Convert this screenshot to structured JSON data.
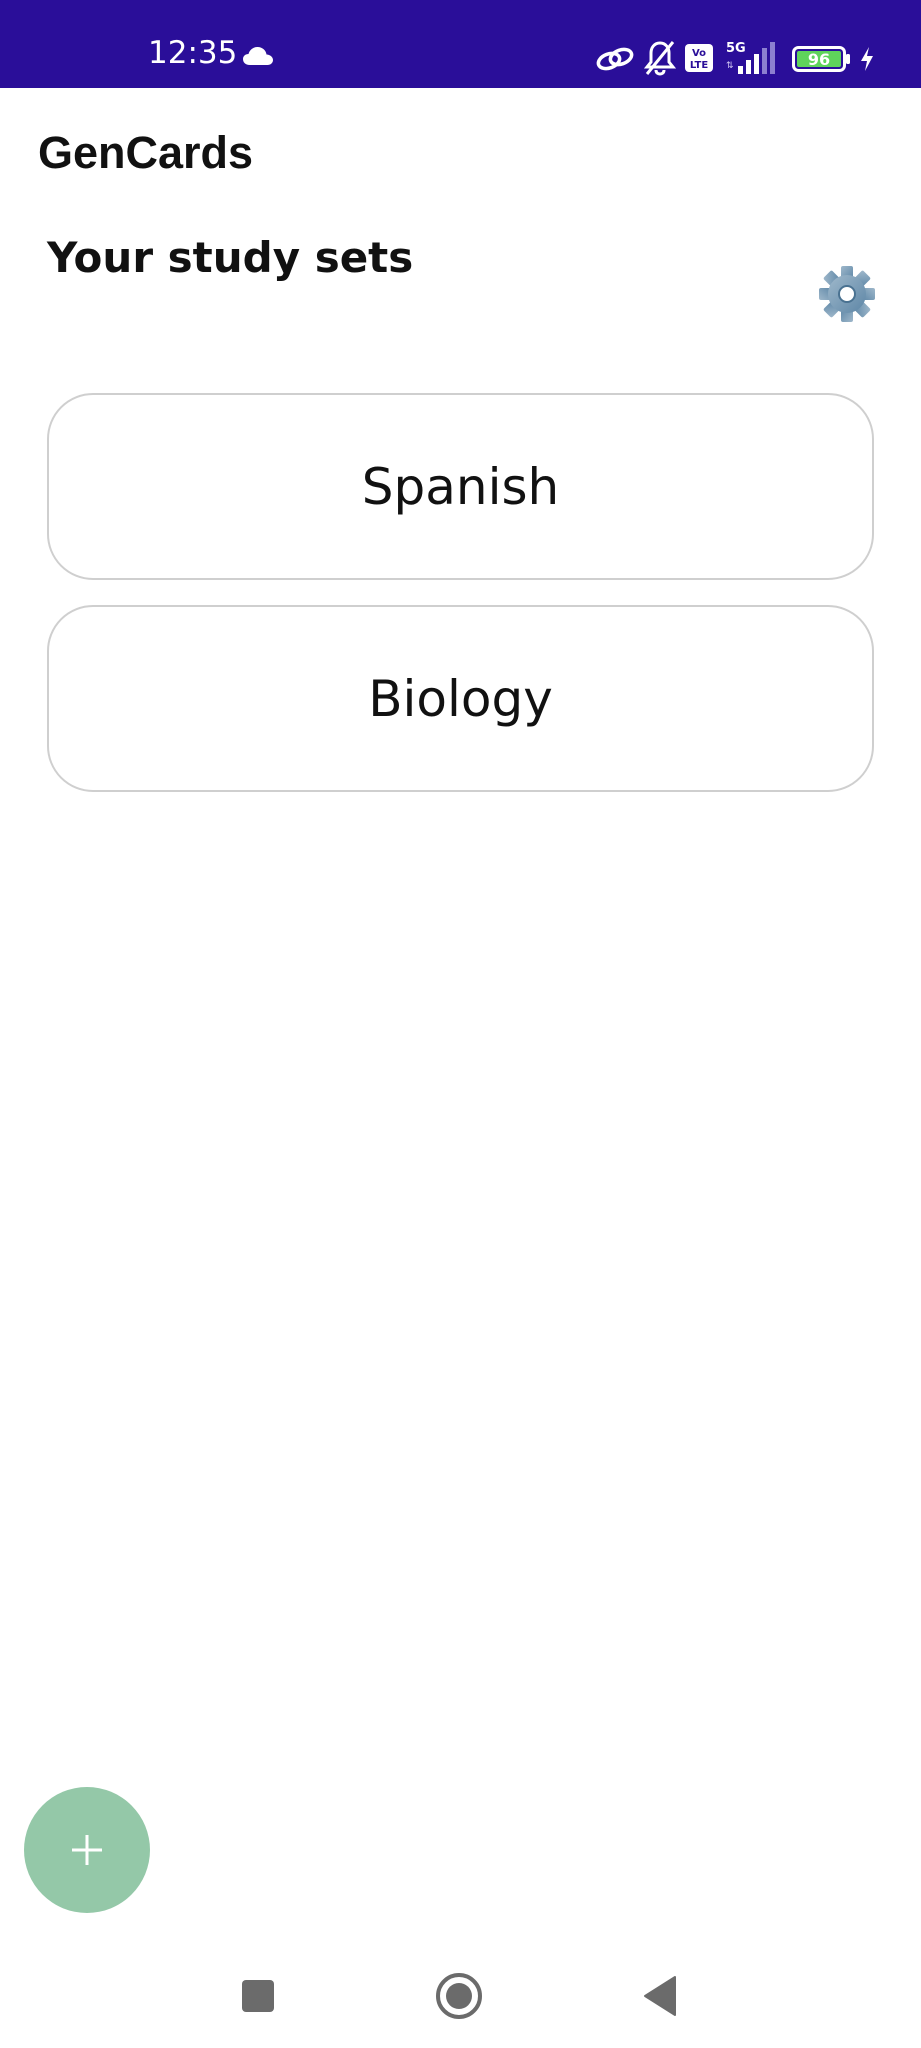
{
  "status_bar": {
    "time": "12:35",
    "battery_level": "96",
    "network": "5G",
    "volte": "Vo LTE",
    "background_color": "#2a0e99",
    "icons": [
      "cloud-icon",
      "link-icon",
      "bell-off-icon",
      "volte-icon",
      "signal-5g-icon",
      "battery-icon",
      "charging-bolt-icon"
    ]
  },
  "app": {
    "title": "GenCards"
  },
  "main": {
    "section_title": "Your study sets",
    "settings_icon": "gear-icon",
    "study_sets": [
      {
        "label": "Spanish"
      },
      {
        "label": "Biology"
      }
    ]
  },
  "fab": {
    "icon": "plus-icon",
    "color": "#94c8a8"
  },
  "navigation": {
    "buttons": [
      "recents-square-icon",
      "home-circle-icon",
      "back-triangle-icon"
    ]
  }
}
